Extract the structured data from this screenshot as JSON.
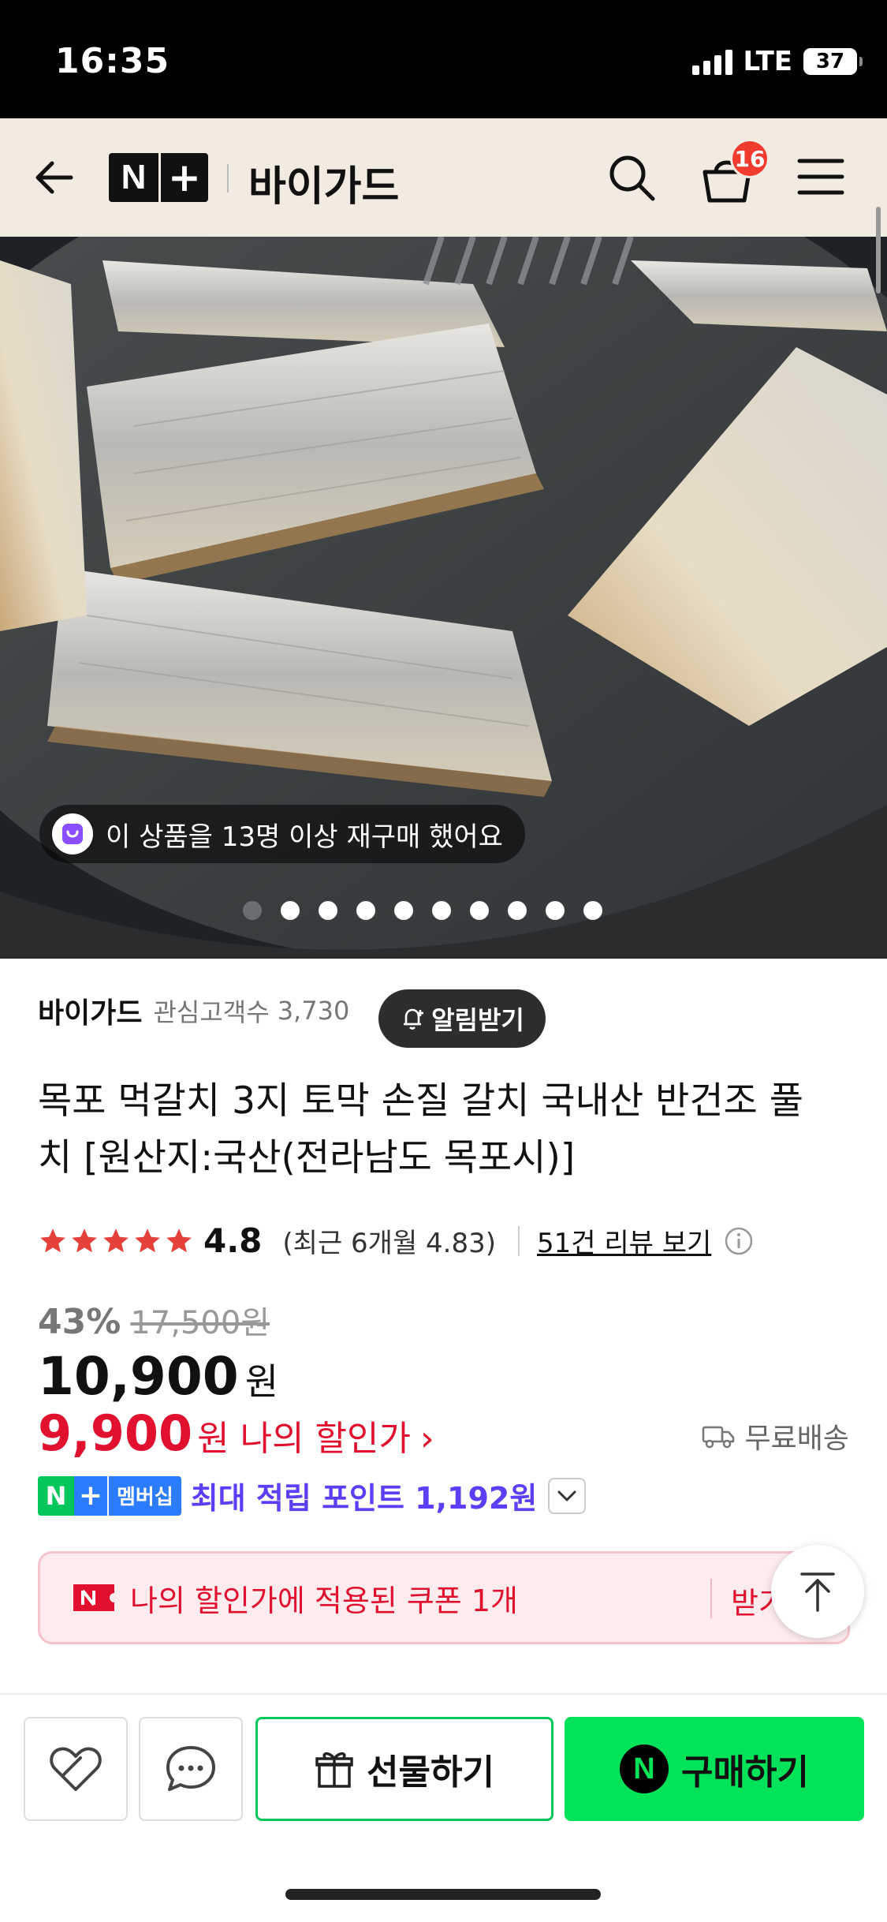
{
  "status_bar": {
    "time": "16:35",
    "network": "LTE",
    "battery": "37"
  },
  "header": {
    "brand_n": "N",
    "brand_plus": "+",
    "store_name": "바이가드",
    "cart_count": "16"
  },
  "gallery": {
    "repurchase_text": "이 상품을 13명 이상 재구매 했어요",
    "dot_count": 10
  },
  "seller": {
    "name": "바이가드",
    "follower_label": "관심고객수",
    "follower_count": "3,730",
    "alert_button": "알림받기"
  },
  "product": {
    "title": "목포 먹갈치 3지 토막 손질 갈치 국내산 반건조 풀치 [원산지:국산(전라남도 목포시)]",
    "rating": "4.8",
    "recent_rating": "(최근 6개월 4.83)",
    "review_link": "51건 리뷰 보기",
    "stars_filled": 5
  },
  "price": {
    "discount_pct": "43%",
    "original": "17,500원",
    "sale": "10,900",
    "sale_unit": "원",
    "my_price": "9,900",
    "my_unit": "원",
    "my_label": "나의 할인가",
    "my_chevron": "›",
    "shipping": "무료배송"
  },
  "membership": {
    "n": "N",
    "plus": "+",
    "badge_text": "멤버십",
    "points_text": "최대 적립 포인트 1,192원"
  },
  "coupon": {
    "text": "나의 할인가에 적용된 쿠폰 1개",
    "get_label": "받기"
  },
  "bottom_bar": {
    "gift_label": "선물하기",
    "buy_label": "구매하기",
    "buy_n": "N"
  },
  "colors": {
    "header_bg": "#f1ebe2",
    "accent_red": "#e0102e",
    "naver_green": "#03e35a",
    "points_purple": "#5b3ef5"
  }
}
